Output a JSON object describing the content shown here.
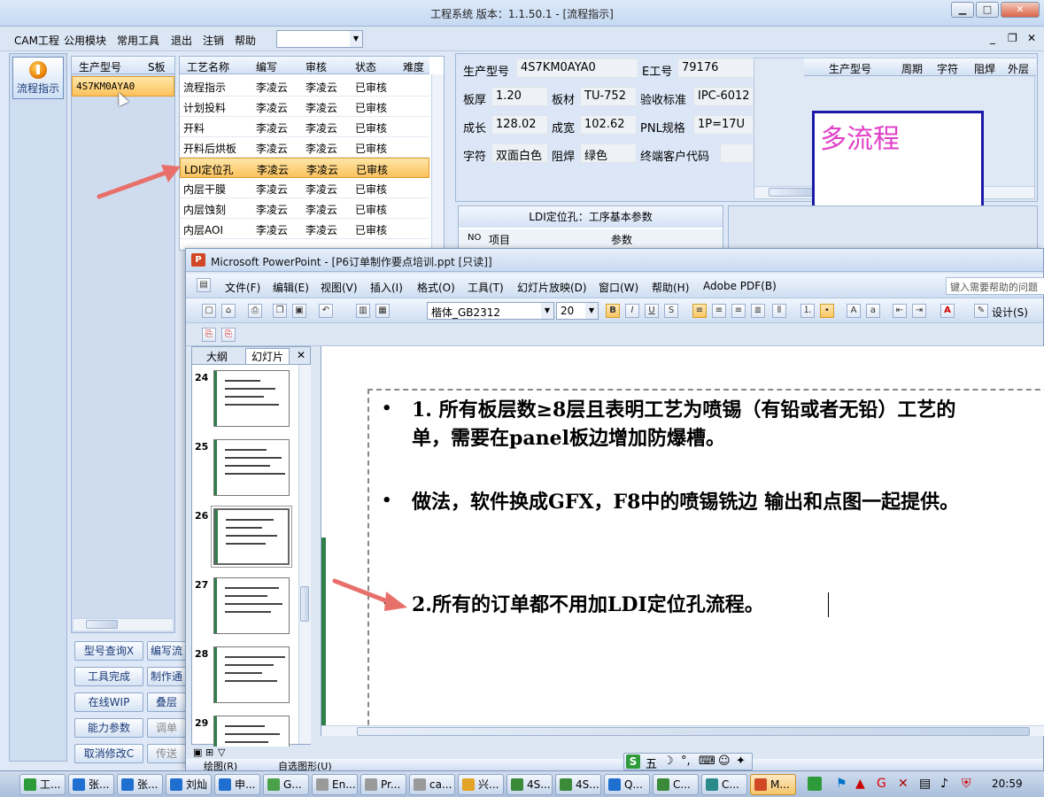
{
  "window": {
    "title": "工程系统   版本：1.1.50.1 - [流程指示]"
  },
  "menu": {
    "items": [
      "CAM工程",
      "公用模块",
      "常用工具",
      "退出",
      "注销",
      "帮助"
    ]
  },
  "left_strip": {
    "flow_button": "流程指示"
  },
  "model_list": {
    "headers": [
      "生产型号",
      "S板"
    ],
    "rows": [
      {
        "model": "4S7KM0AYA0",
        "s": ""
      }
    ]
  },
  "process_grid": {
    "headers": [
      "工艺名称",
      "编写",
      "审核",
      "状态",
      "难度"
    ],
    "rows": [
      {
        "name": "流程指示",
        "writer": "李凌云",
        "reviewer": "李凌云",
        "status": "已审核"
      },
      {
        "name": "计划投料",
        "writer": "李凌云",
        "reviewer": "李凌云",
        "status": "已审核"
      },
      {
        "name": "开料",
        "writer": "李凌云",
        "reviewer": "李凌云",
        "status": "已审核"
      },
      {
        "name": "开料后烘板",
        "writer": "李凌云",
        "reviewer": "李凌云",
        "status": "已审核"
      },
      {
        "name": "LDI定位孔",
        "writer": "李凌云",
        "reviewer": "李凌云",
        "status": "已审核"
      },
      {
        "name": "内层干膜",
        "writer": "李凌云",
        "reviewer": "李凌云",
        "status": "已审核"
      },
      {
        "name": "内层蚀刻",
        "writer": "李凌云",
        "reviewer": "李凌云",
        "status": "已审核"
      },
      {
        "name": "内层AOI",
        "writer": "李凌云",
        "reviewer": "李凌云",
        "status": "已审核"
      }
    ],
    "selected_index": 4
  },
  "info": {
    "labels": {
      "model": "生产型号",
      "eno": "E工号",
      "thickness": "板厚",
      "material": "板材",
      "standard": "验收标准",
      "length": "成长",
      "width": "成宽",
      "pnl": "PNL规格",
      "legend": "字符",
      "mask": "阻焊",
      "customer": "终端客户代码"
    },
    "values": {
      "model": "4S7KM0AYA0",
      "eno": "79176",
      "thickness": "1.20",
      "material": "TU-752",
      "standard": "IPC-6012",
      "length": "128.02",
      "width": "102.62",
      "pnl": "1P=17U",
      "legend": "双面白色",
      "mask": "绿色",
      "customer": ""
    }
  },
  "mini_grid": {
    "headers": [
      "生产型号",
      "周期",
      "字符",
      "阻焊",
      "外层"
    ]
  },
  "multi_flow": {
    "text": "多流程"
  },
  "params": {
    "title": "LDI定位孔：工序基本参数",
    "headers": [
      "NO",
      "项目",
      "参数"
    ]
  },
  "buttons": {
    "col1": [
      "型号查询X",
      "工具完成",
      "在线WIP",
      "能力参数",
      "取消修改C"
    ],
    "col2": [
      "编写流",
      "制作通",
      "叠层",
      "调单",
      "传送"
    ]
  },
  "ppt": {
    "title": "Microsoft PowerPoint - [P6订单制作要点培训.ppt [只读]]",
    "menu": [
      "文件(F)",
      "编辑(E)",
      "视图(V)",
      "插入(I)",
      "格式(O)",
      "工具(T)",
      "幻灯片放映(D)",
      "窗口(W)",
      "帮助(H)",
      "Adobe PDF(B)"
    ],
    "help_placeholder": "键入需要帮助的问题",
    "font": "楷体_GB2312",
    "size": "20",
    "design": "设计(S)",
    "tabs": [
      "大纲",
      "幻灯片"
    ],
    "slides": [
      "24",
      "25",
      "26",
      "27",
      "28",
      "29"
    ],
    "bullets": [
      "1. 所有板层数≥8层且表明工艺为喷锡（有铅或者无铅）工艺的",
      "单，需要在panel板边增加防爆槽。",
      "做法，软件换成GFX，F8中的喷锡铣边 输出和点图一起提供。",
      "2.所有的订单都不用加LDI定位孔流程。"
    ],
    "draw_menu": "绘图(R)",
    "autoshape": "自选图形(U)"
  },
  "ime": {
    "label": "五"
  },
  "taskbar": {
    "buttons": [
      "工...",
      "张...",
      "张...",
      "刘灿",
      "申...",
      "G...",
      "En...",
      "Pr...",
      "ca...",
      "兴...",
      "4S...",
      "4S...",
      "Q...",
      "C...",
      "C...",
      "M..."
    ],
    "clock": "20:59"
  },
  "colors": {
    "accent_orange": "#f7b94b",
    "multi_flow_text": "#e040c8",
    "multi_flow_border": "#1a1aa6"
  }
}
